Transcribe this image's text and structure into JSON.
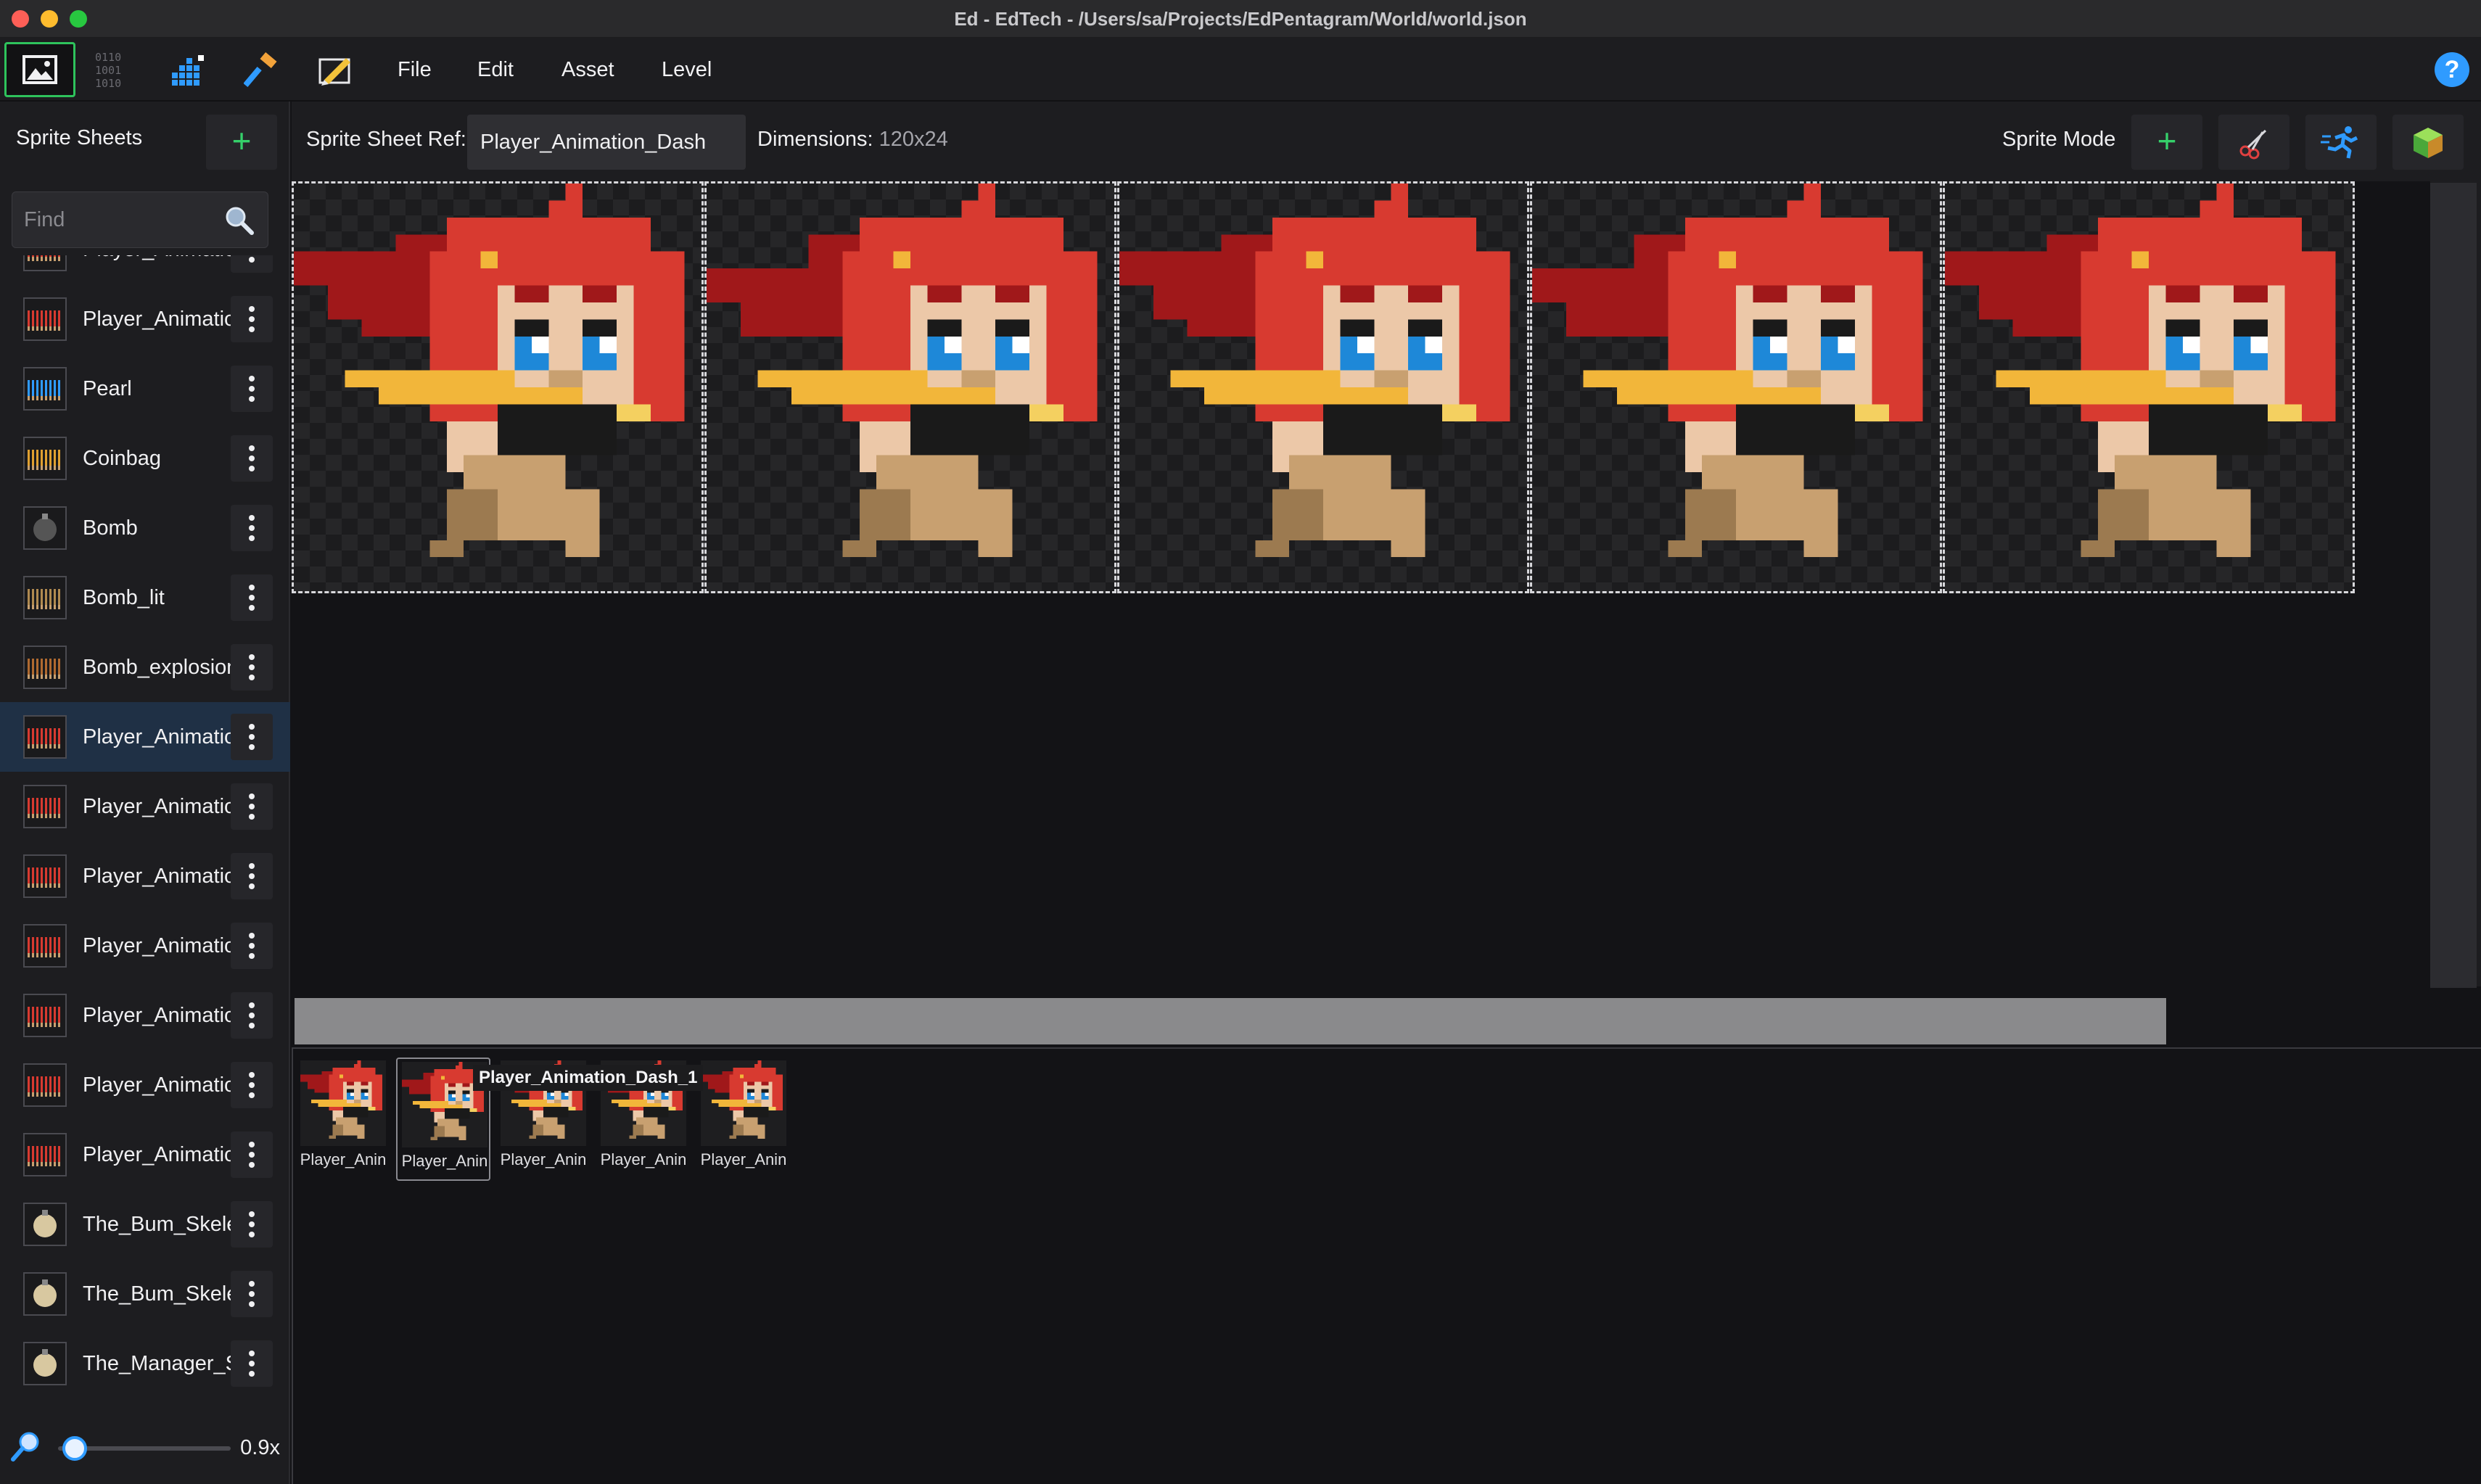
{
  "window": {
    "title": "Ed - EdTech - /Users/sa/Projects/EdPentagram/World/world.json"
  },
  "menubar": {
    "mode_icons": [
      "image-editor-icon",
      "binary-data-icon",
      "tile-bars-icon",
      "hammer-icon",
      "pencil-ruler-icon"
    ],
    "menus": [
      "File",
      "Edit",
      "Asset",
      "Level"
    ],
    "help_label": "?"
  },
  "sidebar": {
    "title": "Sprite Sheets",
    "add_label": "+",
    "search": {
      "placeholder": "Find",
      "value": ""
    },
    "items": [
      {
        "label": "Player_Animatio",
        "thumb": "red-figures"
      },
      {
        "label": "Player_Animatio",
        "thumb": "red-figures"
      },
      {
        "label": "Pearl",
        "thumb": "blue-pearls"
      },
      {
        "label": "Coinbag",
        "thumb": "gold-bags"
      },
      {
        "label": "Bomb",
        "thumb": "dark-bomb"
      },
      {
        "label": "Bomb_lit",
        "thumb": "bomb-strip"
      },
      {
        "label": "Bomb_explosion",
        "thumb": "explosion-strip"
      },
      {
        "label": "Player_Animatio",
        "thumb": "red-figures",
        "selected": true
      },
      {
        "label": "Player_Animatio",
        "thumb": "red-figures"
      },
      {
        "label": "Player_Animatio",
        "thumb": "red-figures"
      },
      {
        "label": "Player_Animatio",
        "thumb": "red-figures"
      },
      {
        "label": "Player_Animatio",
        "thumb": "red-figures"
      },
      {
        "label": "Player_Animatio",
        "thumb": "red-figures"
      },
      {
        "label": "Player_Animatio",
        "thumb": "red-figures"
      },
      {
        "label": "The_Bum_Skeleton",
        "thumb": "skeleton"
      },
      {
        "label": "The_Bum_Skeleton",
        "thumb": "skeleton"
      },
      {
        "label": "The_Manager_Skeleton",
        "thumb": "skeleton"
      }
    ],
    "zoom": {
      "value": "0.9x",
      "level": 0.05
    }
  },
  "toolbar": {
    "ref_label": "Sprite Sheet Ref:",
    "ref_value": "Player_Animation_Dash",
    "dimensions_label": "Dimensions:",
    "dimensions_value": "120x24",
    "mode_label": "Sprite Mode",
    "add_label": "+",
    "tools": [
      "scissors-icon",
      "running-figure-icon",
      "green-cube-icon"
    ]
  },
  "canvas": {
    "frame_count": 5
  },
  "frames_strip": {
    "labels": [
      "Player_Anin",
      "Player_Anin",
      "Player_Anin",
      "Player_Anin",
      "Player_Anin"
    ],
    "selected_index": 1,
    "tooltip": "Player_Animation_Dash_1"
  },
  "colors": {
    "accent_green": "#2ec35c",
    "accent_blue": "#2f9bff",
    "hair_red": "#d83a30",
    "scarf_yellow": "#f2b63a",
    "selection_blue": "#1f3045"
  }
}
